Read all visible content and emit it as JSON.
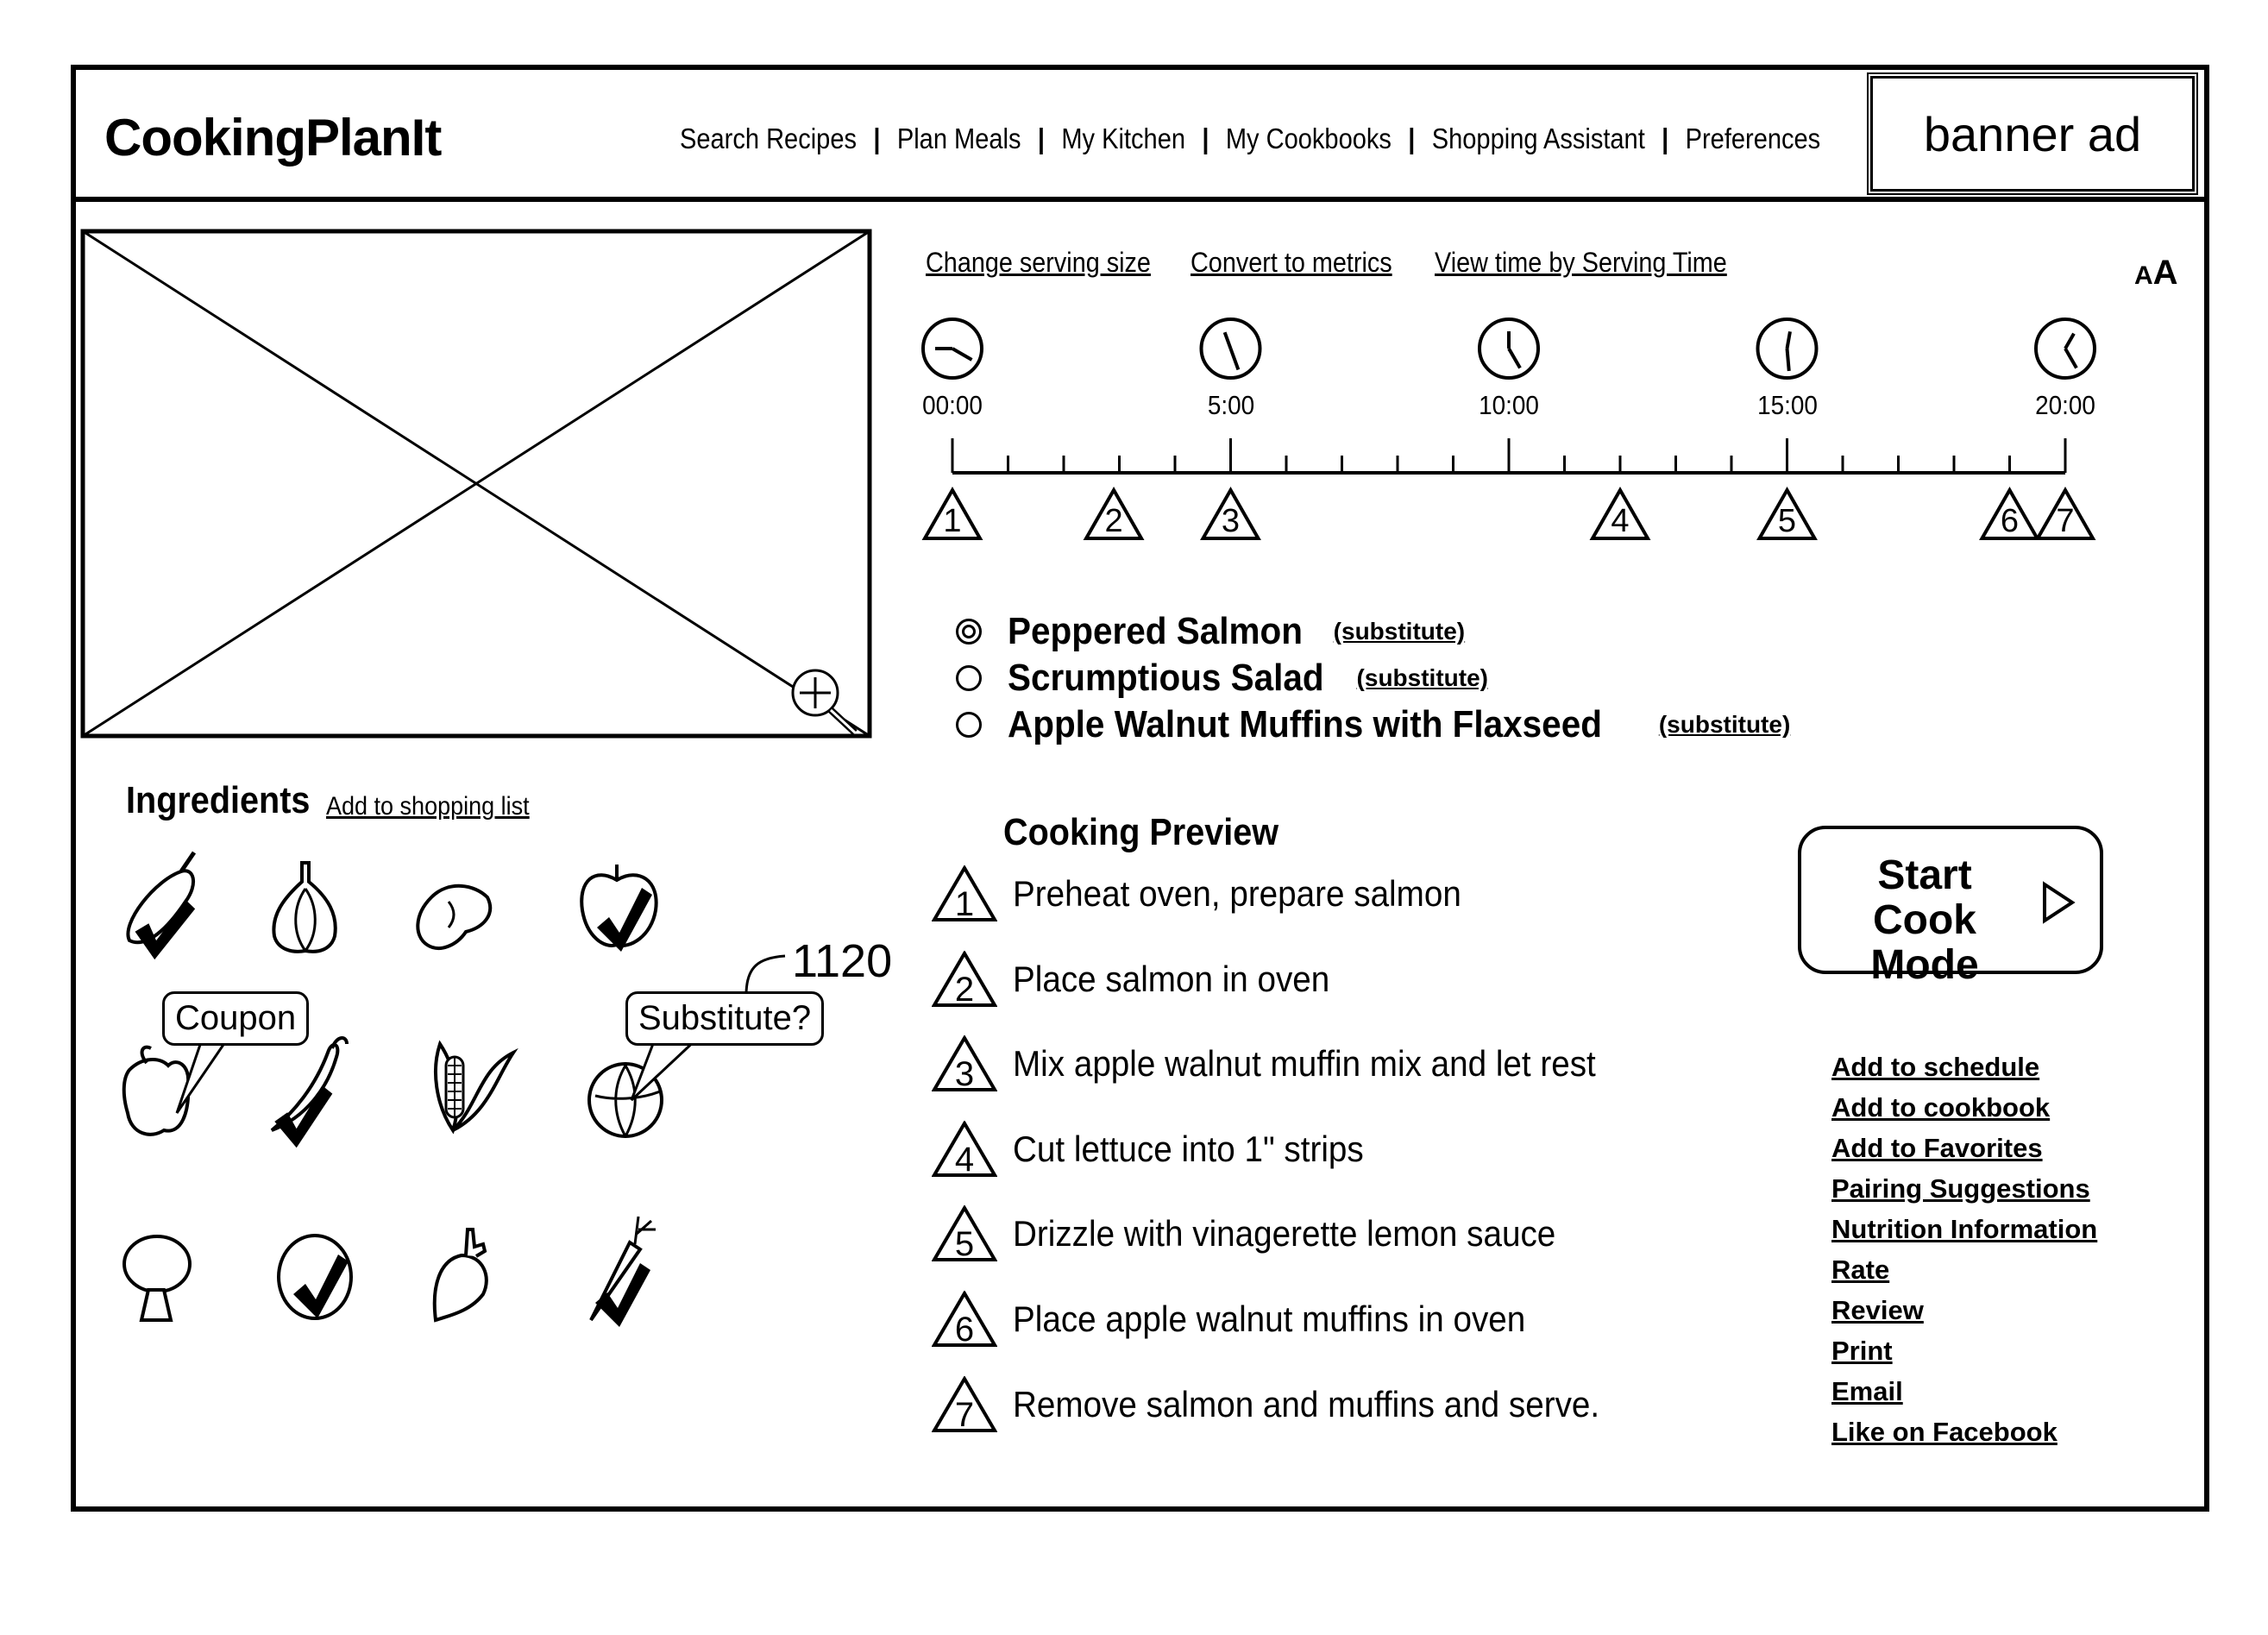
{
  "header": {
    "app_title": "CookingPlanIt",
    "nav": [
      {
        "label": "Search Recipes"
      },
      {
        "label": "Plan Meals"
      },
      {
        "label": "My Kitchen"
      },
      {
        "label": "My Cookbooks"
      },
      {
        "label": "Shopping Assistant"
      },
      {
        "label": "Preferences"
      }
    ],
    "nav_separator": "|",
    "banner_ad": "banner ad"
  },
  "photo": {
    "placeholder_icon": "image-placeholder-icon",
    "zoom_icon": "zoom-in-icon"
  },
  "recipe_links": {
    "change_serving_size": "Change serving size",
    "convert_to_metrics": "Convert to metrics",
    "view_time_by_serving_time": "View time by Serving Time"
  },
  "text_size_control": {
    "small": "A",
    "large": "A"
  },
  "timeline": {
    "markers": [
      {
        "label": "00:00",
        "minutes": 0
      },
      {
        "label": "5:00",
        "minutes": 5
      },
      {
        "label": "10:00",
        "minutes": 10
      },
      {
        "label": "15:00",
        "minutes": 15
      },
      {
        "label": "20:00",
        "minutes": 20
      }
    ],
    "range_minutes": [
      0,
      20
    ],
    "minor_tick_minutes": 1,
    "steps": [
      {
        "number": "1",
        "minutes": 0
      },
      {
        "number": "2",
        "minutes": 2.9
      },
      {
        "number": "3",
        "minutes": 5
      },
      {
        "number": "4",
        "minutes": 12
      },
      {
        "number": "5",
        "minutes": 15
      },
      {
        "number": "6",
        "minutes": 19
      },
      {
        "number": "7",
        "minutes": 20
      }
    ]
  },
  "recipes": [
    {
      "name": "Peppered Salmon",
      "substitute_label": "(substitute)",
      "selected": true
    },
    {
      "name": "Scrumptious Salad",
      "substitute_label": "(substitute)",
      "selected": false
    },
    {
      "name": "Apple Walnut Muffins with Flaxseed",
      "substitute_label": "(substitute)",
      "selected": false
    }
  ],
  "ingredients": {
    "title": "Ingredients",
    "add_to_shopping_list": "Add to shopping list",
    "items": [
      {
        "name": "eggplant",
        "checked": true
      },
      {
        "name": "garlic",
        "checked": false
      },
      {
        "name": "potato",
        "checked": false
      },
      {
        "name": "apple",
        "checked": true
      },
      {
        "name": "bell-pepper",
        "checked": false,
        "bubble": "Coupon"
      },
      {
        "name": "chili-pepper",
        "checked": true
      },
      {
        "name": "corn",
        "checked": false
      },
      {
        "name": "cabbage",
        "checked": false,
        "bubble": "Substitute?"
      },
      {
        "name": "mushroom",
        "checked": false
      },
      {
        "name": "lemon",
        "checked": true
      },
      {
        "name": "beet",
        "checked": false
      },
      {
        "name": "carrot",
        "checked": true
      }
    ],
    "callout_reference": "1120"
  },
  "cooking_preview": {
    "title": "Cooking Preview",
    "steps": [
      {
        "number": "1",
        "text": "Preheat oven, prepare salmon"
      },
      {
        "number": "2",
        "text": "Place salmon in oven"
      },
      {
        "number": "3",
        "text": "Mix apple walnut muffin mix and let rest"
      },
      {
        "number": "4",
        "text": "Cut lettuce into 1\" strips"
      },
      {
        "number": "5",
        "text": "Drizzle with vinagerette lemon sauce"
      },
      {
        "number": "6",
        "text": "Place apple walnut muffins in oven"
      },
      {
        "number": "7",
        "text": "Remove salmon and muffins and serve."
      }
    ]
  },
  "start_cook_mode": {
    "label_line1": "Start Cook",
    "label_line2": "Mode",
    "icon": "play-icon"
  },
  "side_links": [
    "Add to schedule",
    "Add to cookbook",
    "Add to Favorites",
    "Pairing Suggestions",
    "Nutrition Information",
    "Rate",
    "Review",
    "Print",
    "Email",
    "Like on Facebook"
  ]
}
